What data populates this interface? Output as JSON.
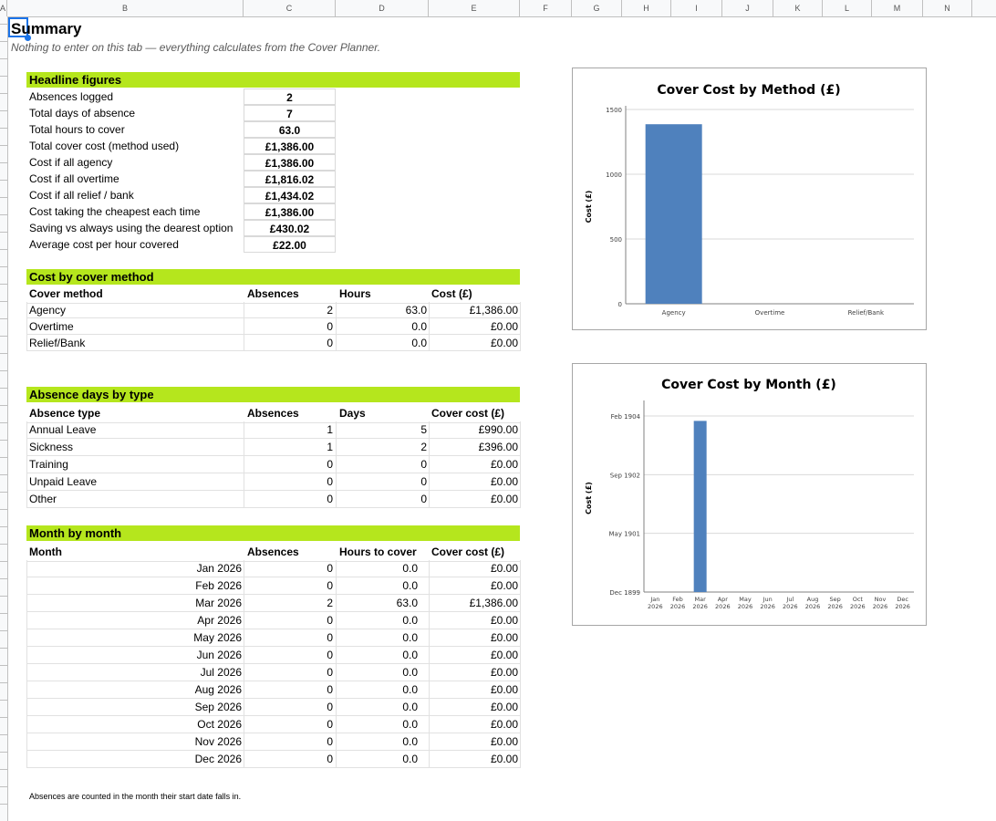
{
  "columns": [
    "A",
    "B",
    "C",
    "D",
    "E",
    "F",
    "G",
    "H",
    "I",
    "J",
    "K",
    "L",
    "M",
    "N"
  ],
  "summary_title": "Summary",
  "subtitle": "Nothing to enter on this tab — everything calculates from the Cover Planner.",
  "headline": {
    "title": "Headline figures",
    "rows": [
      {
        "label": "Absences logged",
        "value": "2"
      },
      {
        "label": "Total days of absence",
        "value": "7"
      },
      {
        "label": "Total hours to cover",
        "value": "63.0"
      },
      {
        "label": "Total cover cost (method used)",
        "value": "£1,386.00"
      },
      {
        "label": "Cost if all agency",
        "value": "£1,386.00"
      },
      {
        "label": "Cost if all overtime",
        "value": "£1,816.02"
      },
      {
        "label": "Cost if all relief / bank",
        "value": "£1,434.02"
      },
      {
        "label": "Cost taking the cheapest each time",
        "value": "£1,386.00"
      },
      {
        "label": "Saving vs always using the dearest option",
        "value": "£430.02"
      },
      {
        "label": "Average cost per hour covered",
        "value": "£22.00"
      }
    ]
  },
  "method": {
    "title": "Cost by cover method",
    "headers": [
      "Cover method",
      "Absences",
      "Hours",
      "Cost (£)"
    ],
    "rows": [
      [
        "Agency",
        "2",
        "63.0",
        "£1,386.00"
      ],
      [
        "Overtime",
        "0",
        "0.0",
        "£0.00"
      ],
      [
        "Relief/Bank",
        "0",
        "0.0",
        "£0.00"
      ]
    ]
  },
  "absence_type": {
    "title": "Absence days by type",
    "headers": [
      "Absence type",
      "Absences",
      "Days",
      "Cover cost (£)"
    ],
    "rows": [
      [
        "Annual Leave",
        "1",
        "5",
        "£990.00"
      ],
      [
        "Sickness",
        "1",
        "2",
        "£396.00"
      ],
      [
        "Training",
        "0",
        "0",
        "£0.00"
      ],
      [
        "Unpaid Leave",
        "0",
        "0",
        "£0.00"
      ],
      [
        "Other",
        "0",
        "0",
        "£0.00"
      ]
    ]
  },
  "monthly": {
    "title": "Month by month",
    "headers": [
      "Month",
      "Absences",
      "Hours to cover",
      "Cover cost (£)"
    ],
    "rows": [
      [
        "Jan 2026",
        "0",
        "0.0",
        "£0.00"
      ],
      [
        "Feb 2026",
        "0",
        "0.0",
        "£0.00"
      ],
      [
        "Mar 2026",
        "2",
        "63.0",
        "£1,386.00"
      ],
      [
        "Apr 2026",
        "0",
        "0.0",
        "£0.00"
      ],
      [
        "May 2026",
        "0",
        "0.0",
        "£0.00"
      ],
      [
        "Jun 2026",
        "0",
        "0.0",
        "£0.00"
      ],
      [
        "Jul 2026",
        "0",
        "0.0",
        "£0.00"
      ],
      [
        "Aug 2026",
        "0",
        "0.0",
        "£0.00"
      ],
      [
        "Sep 2026",
        "0",
        "0.0",
        "£0.00"
      ],
      [
        "Oct 2026",
        "0",
        "0.0",
        "£0.00"
      ],
      [
        "Nov 2026",
        "0",
        "0.0",
        "£0.00"
      ],
      [
        "Dec 2026",
        "0",
        "0.0",
        "£0.00"
      ]
    ]
  },
  "note": "Absences are counted in the month their start date falls in.",
  "chart_data": [
    {
      "type": "bar",
      "title": "Cover Cost by Method (£)",
      "ylabel": "Cost (£)",
      "xlabel": "",
      "categories": [
        "Agency",
        "Overtime",
        "Relief/Bank"
      ],
      "values": [
        1386,
        0,
        0
      ],
      "ylim": [
        0,
        1500
      ],
      "yticks": [
        "0",
        "500",
        "1000",
        "1500"
      ],
      "grid": true,
      "bar_color": "#4f81bd"
    },
    {
      "type": "bar",
      "title": "Cover Cost by Month (£)",
      "ylabel": "Cost (£)",
      "xlabel": "",
      "categories": [
        "Jan 2026",
        "Feb 2026",
        "Mar 2026",
        "Apr 2026",
        "May 2026",
        "Jun 2026",
        "Jul 2026",
        "Aug 2026",
        "Sep 2026",
        "Oct 2026",
        "Nov 2026",
        "Dec 2026"
      ],
      "values": [
        0,
        0,
        1386,
        0,
        0,
        0,
        0,
        0,
        0,
        0,
        0,
        0
      ],
      "ylim": [
        0,
        1522
      ],
      "yticks": [
        "Dec 1899",
        "May 1901",
        "Sep 1902",
        "Feb 1904"
      ],
      "grid": true,
      "bar_color": "#4f81bd"
    }
  ]
}
